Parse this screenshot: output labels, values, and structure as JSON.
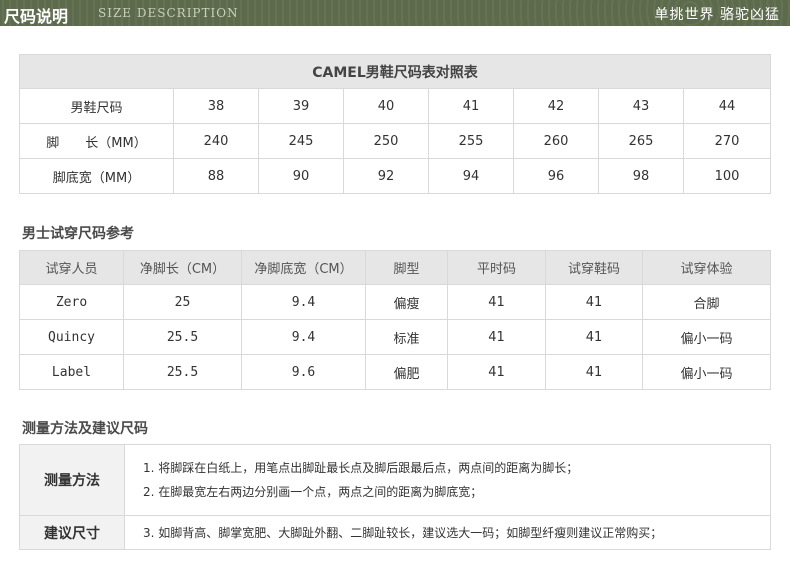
{
  "header": {
    "title": "尺码说明",
    "subtitle": "SIZE DESCRIPTION",
    "slogan": "单挑世界 骆驼凶猛"
  },
  "size_chart": {
    "caption": "CAMEL男鞋尺码表对照表",
    "rows": [
      {
        "label": "男鞋尺码",
        "values": [
          "38",
          "39",
          "40",
          "41",
          "42",
          "43",
          "44"
        ]
      },
      {
        "label": "脚　　长（MM）",
        "values": [
          "240",
          "245",
          "250",
          "255",
          "260",
          "265",
          "270"
        ]
      },
      {
        "label": "脚底宽（MM）",
        "values": [
          "88",
          "90",
          "92",
          "94",
          "96",
          "98",
          "100"
        ]
      }
    ]
  },
  "trial_section": {
    "title": "男士试穿尺码参考",
    "headers": [
      "试穿人员",
      "净脚长（CM）",
      "净脚底宽（CM）",
      "脚型",
      "平时码",
      "试穿鞋码",
      "试穿体验"
    ],
    "rows": [
      [
        "Zero",
        "25",
        "9.4",
        "偏瘦",
        "41",
        "41",
        "合脚"
      ],
      [
        "Quincy",
        "25.5",
        "9.4",
        "标准",
        "41",
        "41",
        "偏小一码"
      ],
      [
        "Label",
        "25.5",
        "9.6",
        "偏肥",
        "41",
        "41",
        "偏小一码"
      ]
    ]
  },
  "method_section": {
    "title": "测量方法及建议尺码",
    "measure_label": "测量方法",
    "measure_lines": [
      "1. 将脚踩在白纸上，用笔点出脚趾最长点及脚后跟最后点，两点间的距离为脚长；",
      "2. 在脚最宽左右两边分别画一个点，两点之间的距离为脚底宽；"
    ],
    "advice_label": "建议尺寸",
    "advice_lines": [
      "3. 如脚背高、脚掌宽肥、大脚趾外翻、二脚趾较长，建议选大一码；如脚型纤瘦则建议正常购买；"
    ]
  }
}
